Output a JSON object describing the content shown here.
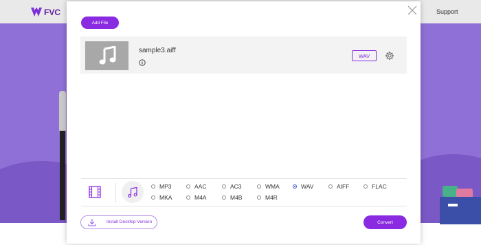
{
  "background": {
    "logo_text": "FVC",
    "nav_support": "Support"
  },
  "modal": {
    "add_file_label": "Add File",
    "file": {
      "name": "sample3.aiff",
      "output_format": "WAV"
    },
    "formats": {
      "selected": "WAV",
      "options": [
        "MP3",
        "AAC",
        "AC3",
        "WMA",
        "WAV",
        "AIFF",
        "FLAC",
        "MKA",
        "M4A",
        "M4B",
        "M4R"
      ]
    },
    "install_label": "Install Desktop Version",
    "convert_label": "Convert"
  },
  "colors": {
    "accent": "#8a2be2",
    "radio_selected": "#3b55c9",
    "background_purple": "#8f70d6"
  }
}
